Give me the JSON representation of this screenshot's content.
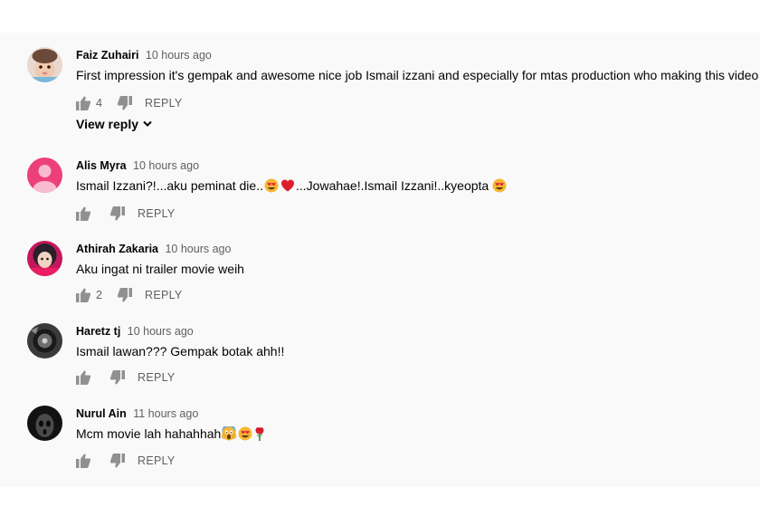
{
  "comments": [
    {
      "author": "Faiz Zuhairi",
      "time": "10 hours ago",
      "text": "First impression it's gempak and awesome nice job Ismail izzani and especially for mtas production  who making this video",
      "likes": "4",
      "reply_label": "REPLY",
      "view_reply_label": "View reply",
      "avatar": "baby-photo"
    },
    {
      "author": "Alis Myra",
      "time": "10 hours ago",
      "text_parts": [
        "Ismail Izzani?!...aku peminat die..",
        "...Jowahae!.Ismail Izzani!..kyeopta"
      ],
      "emojis": [
        "heart-eyes-emoji",
        "red-heart-emoji",
        "heart-eyes-emoji"
      ],
      "likes": "",
      "reply_label": "REPLY",
      "avatar": "default-pink",
      "avatar_color": "#ec407a"
    },
    {
      "author": "Athirah Zakaria",
      "time": "10 hours ago",
      "text": "Aku ingat ni trailer movie weih",
      "likes": "2",
      "reply_label": "REPLY",
      "avatar": "girl-photo"
    },
    {
      "author": "Haretz tj",
      "time": "10 hours ago",
      "text": "Ismail lawan??? Gempak botak ahh!!",
      "likes": "",
      "reply_label": "REPLY",
      "avatar": "dark-photo"
    },
    {
      "author": "Nurul Ain",
      "time": "11 hours ago",
      "text": "Mcm movie lah hahahhah",
      "emojis": [
        "screaming-face-emoji",
        "heart-eyes-emoji",
        "rose-emoji"
      ],
      "likes": "",
      "reply_label": "REPLY",
      "avatar": "ghost-photo"
    }
  ],
  "colors": {
    "text": "#030303",
    "secondary": "#606060",
    "background": "#f9f9f9"
  }
}
